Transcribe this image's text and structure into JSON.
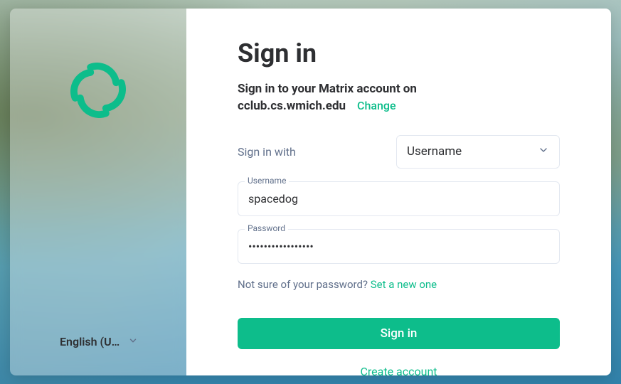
{
  "language": {
    "selected": "English (U…"
  },
  "auth": {
    "heading": "Sign in",
    "subheading_prefix": "Sign in to your Matrix account on",
    "server": "cclub.cs.wmich.edu",
    "change_label": "Change",
    "signin_with_label": "Sign in with",
    "method_selected": "Username",
    "username_label": "Username",
    "username_value": "spacedog",
    "password_label": "Password",
    "password_value": "•••••••••••••••••",
    "password_hint": "Not sure of your password? ",
    "password_reset": "Set a new one",
    "submit_label": "Sign in",
    "create_label": "Create account"
  },
  "colors": {
    "accent": "#0dbd8b"
  }
}
